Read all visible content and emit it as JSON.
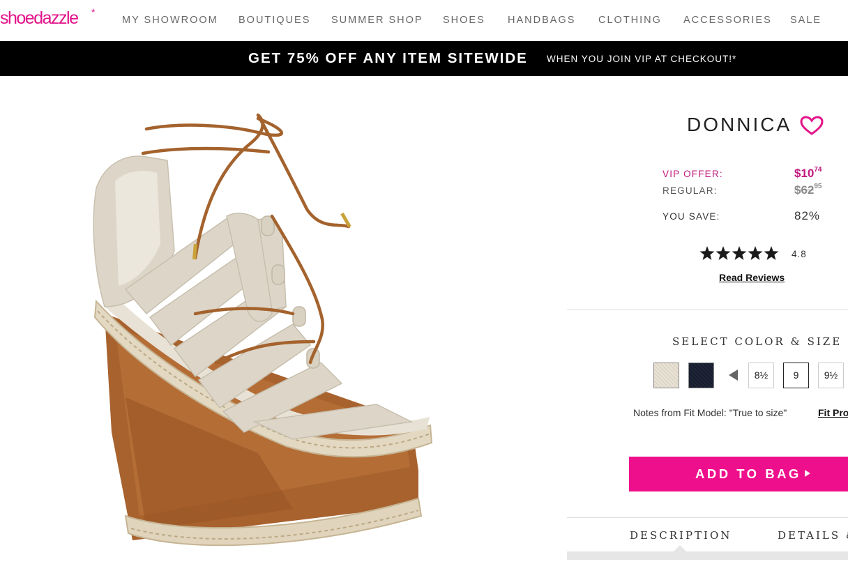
{
  "brand": {
    "logo_text": "shoedazzle",
    "logo_mark": "*",
    "accent_color": "#e3138a"
  },
  "nav": {
    "items": [
      "MY SHOWROOM",
      "BOUTIQUES",
      "SUMMER SHOP",
      "SHOES",
      "HANDBAGS",
      "CLOTHING",
      "ACCESSORIES",
      "SALE"
    ]
  },
  "banner": {
    "main": "GET 75% OFF ANY ITEM SITEWIDE",
    "sub": "WHEN YOU JOIN VIP AT CHECKOUT!*"
  },
  "product": {
    "name": "DONNICA",
    "image_alt": "lace-up espadrille wedge sandal",
    "favorite_icon": "heart-outline-icon",
    "pricing": {
      "vip_label": "VIP OFFER:",
      "vip_price_main": "$10",
      "vip_price_cents": "74",
      "regular_label": "REGULAR:",
      "regular_price_main": "$62",
      "regular_price_cents": "95",
      "save_label": "YOU SAVE:",
      "save_value": "82%"
    },
    "rating": {
      "stars": 5,
      "value": "4.8",
      "read_reviews": "Read Reviews"
    },
    "selector": {
      "heading": "SELECT COLOR & SIZE",
      "colors": [
        {
          "name": "natural",
          "hex": "#e4ddd0"
        },
        {
          "name": "navy",
          "hex": "#1b2233"
        }
      ],
      "sizes": [
        "8½",
        "9",
        "9½"
      ],
      "selected_size": "9"
    },
    "fit_note": "Notes from Fit Model: \"True to size\"",
    "fit_link": "Fit Pro",
    "add_to_bag": "ADD TO BAG",
    "tabs": [
      "DESCRIPTION",
      "DETAILS &"
    ]
  }
}
